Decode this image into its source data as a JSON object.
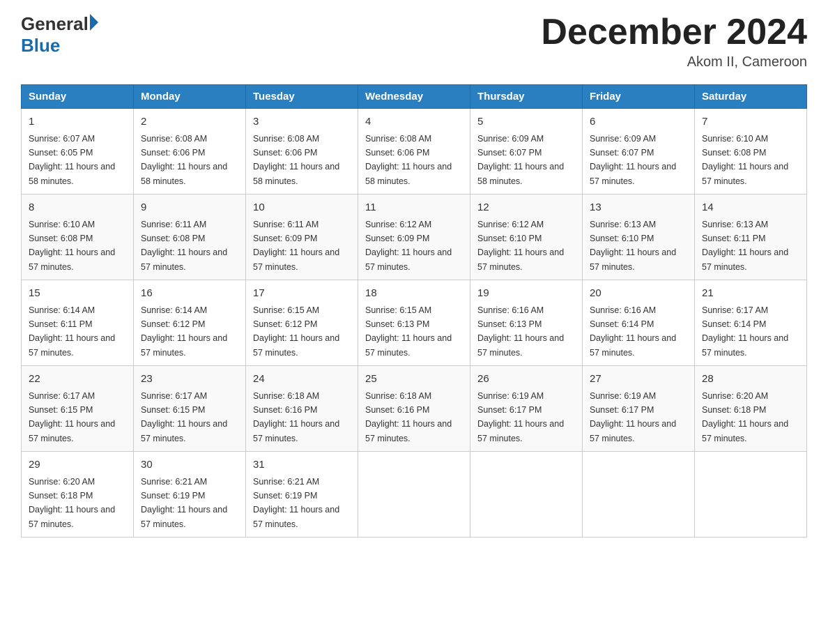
{
  "header": {
    "logo_general": "General",
    "logo_blue": "Blue",
    "month_title": "December 2024",
    "location": "Akom II, Cameroon"
  },
  "days_of_week": [
    "Sunday",
    "Monday",
    "Tuesday",
    "Wednesday",
    "Thursday",
    "Friday",
    "Saturday"
  ],
  "weeks": [
    [
      {
        "day": "1",
        "sunrise": "6:07 AM",
        "sunset": "6:05 PM",
        "daylight": "11 hours and 58 minutes."
      },
      {
        "day": "2",
        "sunrise": "6:08 AM",
        "sunset": "6:06 PM",
        "daylight": "11 hours and 58 minutes."
      },
      {
        "day": "3",
        "sunrise": "6:08 AM",
        "sunset": "6:06 PM",
        "daylight": "11 hours and 58 minutes."
      },
      {
        "day": "4",
        "sunrise": "6:08 AM",
        "sunset": "6:06 PM",
        "daylight": "11 hours and 58 minutes."
      },
      {
        "day": "5",
        "sunrise": "6:09 AM",
        "sunset": "6:07 PM",
        "daylight": "11 hours and 58 minutes."
      },
      {
        "day": "6",
        "sunrise": "6:09 AM",
        "sunset": "6:07 PM",
        "daylight": "11 hours and 57 minutes."
      },
      {
        "day": "7",
        "sunrise": "6:10 AM",
        "sunset": "6:08 PM",
        "daylight": "11 hours and 57 minutes."
      }
    ],
    [
      {
        "day": "8",
        "sunrise": "6:10 AM",
        "sunset": "6:08 PM",
        "daylight": "11 hours and 57 minutes."
      },
      {
        "day": "9",
        "sunrise": "6:11 AM",
        "sunset": "6:08 PM",
        "daylight": "11 hours and 57 minutes."
      },
      {
        "day": "10",
        "sunrise": "6:11 AM",
        "sunset": "6:09 PM",
        "daylight": "11 hours and 57 minutes."
      },
      {
        "day": "11",
        "sunrise": "6:12 AM",
        "sunset": "6:09 PM",
        "daylight": "11 hours and 57 minutes."
      },
      {
        "day": "12",
        "sunrise": "6:12 AM",
        "sunset": "6:10 PM",
        "daylight": "11 hours and 57 minutes."
      },
      {
        "day": "13",
        "sunrise": "6:13 AM",
        "sunset": "6:10 PM",
        "daylight": "11 hours and 57 minutes."
      },
      {
        "day": "14",
        "sunrise": "6:13 AM",
        "sunset": "6:11 PM",
        "daylight": "11 hours and 57 minutes."
      }
    ],
    [
      {
        "day": "15",
        "sunrise": "6:14 AM",
        "sunset": "6:11 PM",
        "daylight": "11 hours and 57 minutes."
      },
      {
        "day": "16",
        "sunrise": "6:14 AM",
        "sunset": "6:12 PM",
        "daylight": "11 hours and 57 minutes."
      },
      {
        "day": "17",
        "sunrise": "6:15 AM",
        "sunset": "6:12 PM",
        "daylight": "11 hours and 57 minutes."
      },
      {
        "day": "18",
        "sunrise": "6:15 AM",
        "sunset": "6:13 PM",
        "daylight": "11 hours and 57 minutes."
      },
      {
        "day": "19",
        "sunrise": "6:16 AM",
        "sunset": "6:13 PM",
        "daylight": "11 hours and 57 minutes."
      },
      {
        "day": "20",
        "sunrise": "6:16 AM",
        "sunset": "6:14 PM",
        "daylight": "11 hours and 57 minutes."
      },
      {
        "day": "21",
        "sunrise": "6:17 AM",
        "sunset": "6:14 PM",
        "daylight": "11 hours and 57 minutes."
      }
    ],
    [
      {
        "day": "22",
        "sunrise": "6:17 AM",
        "sunset": "6:15 PM",
        "daylight": "11 hours and 57 minutes."
      },
      {
        "day": "23",
        "sunrise": "6:17 AM",
        "sunset": "6:15 PM",
        "daylight": "11 hours and 57 minutes."
      },
      {
        "day": "24",
        "sunrise": "6:18 AM",
        "sunset": "6:16 PM",
        "daylight": "11 hours and 57 minutes."
      },
      {
        "day": "25",
        "sunrise": "6:18 AM",
        "sunset": "6:16 PM",
        "daylight": "11 hours and 57 minutes."
      },
      {
        "day": "26",
        "sunrise": "6:19 AM",
        "sunset": "6:17 PM",
        "daylight": "11 hours and 57 minutes."
      },
      {
        "day": "27",
        "sunrise": "6:19 AM",
        "sunset": "6:17 PM",
        "daylight": "11 hours and 57 minutes."
      },
      {
        "day": "28",
        "sunrise": "6:20 AM",
        "sunset": "6:18 PM",
        "daylight": "11 hours and 57 minutes."
      }
    ],
    [
      {
        "day": "29",
        "sunrise": "6:20 AM",
        "sunset": "6:18 PM",
        "daylight": "11 hours and 57 minutes."
      },
      {
        "day": "30",
        "sunrise": "6:21 AM",
        "sunset": "6:19 PM",
        "daylight": "11 hours and 57 minutes."
      },
      {
        "day": "31",
        "sunrise": "6:21 AM",
        "sunset": "6:19 PM",
        "daylight": "11 hours and 57 minutes."
      },
      null,
      null,
      null,
      null
    ]
  ]
}
